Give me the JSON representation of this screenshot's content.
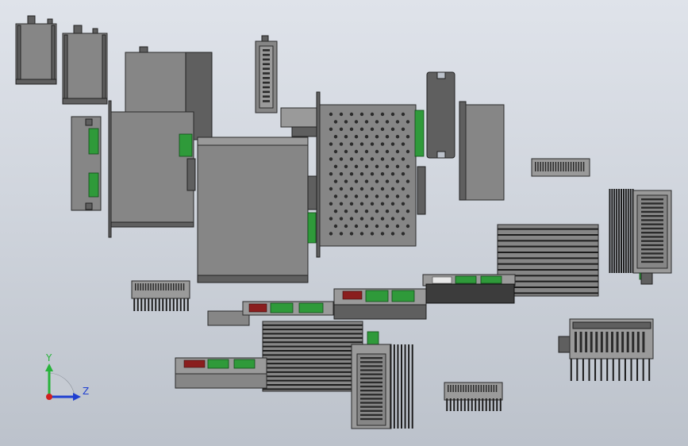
{
  "viewport": {
    "background_top": "#dfe3ea",
    "background_bottom": "#bcc2cb"
  },
  "triad": {
    "y_label": "Y",
    "z_label": "Z",
    "y_color": "#27b33a",
    "z_color": "#1f3fd0",
    "x_color": "#d11f1f"
  },
  "colors": {
    "housing": "#868686",
    "housing_light": "#9a9a9a",
    "housing_dark": "#5f5f5f",
    "housing_black": "#3c3c3c",
    "terminal_green": "#2f9a3a",
    "terminal_red": "#8a1e1e",
    "outline": "#2a2a2a"
  }
}
